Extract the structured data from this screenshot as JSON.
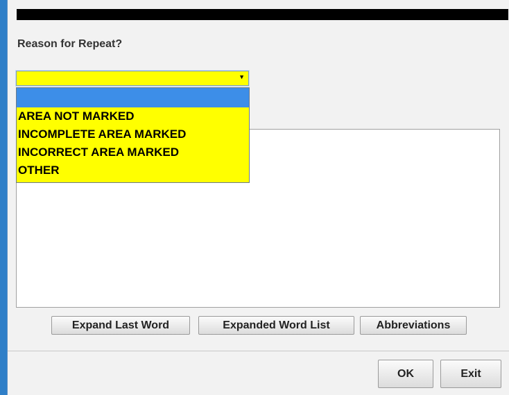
{
  "dialog": {
    "prompt": "Reason for Repeat?",
    "select": {
      "selected_value": "",
      "arrow": "▼"
    },
    "dropdown_options": [
      "",
      "AREA NOT MARKED",
      "INCOMPLETE AREA MARKED",
      "INCORRECT AREA MARKED",
      "OTHER"
    ],
    "text_area_value": ""
  },
  "buttons": {
    "expand_last_word": "Expand Last Word",
    "expanded_word_list": "Expanded Word List",
    "abbreviations": "Abbreviations",
    "ok": "OK",
    "exit": "Exit"
  },
  "colors": {
    "highlight_yellow": "#ffff00",
    "selection_blue": "#3d8ee8",
    "title_bar": "#000000",
    "window_border": "#2f7fc8"
  }
}
